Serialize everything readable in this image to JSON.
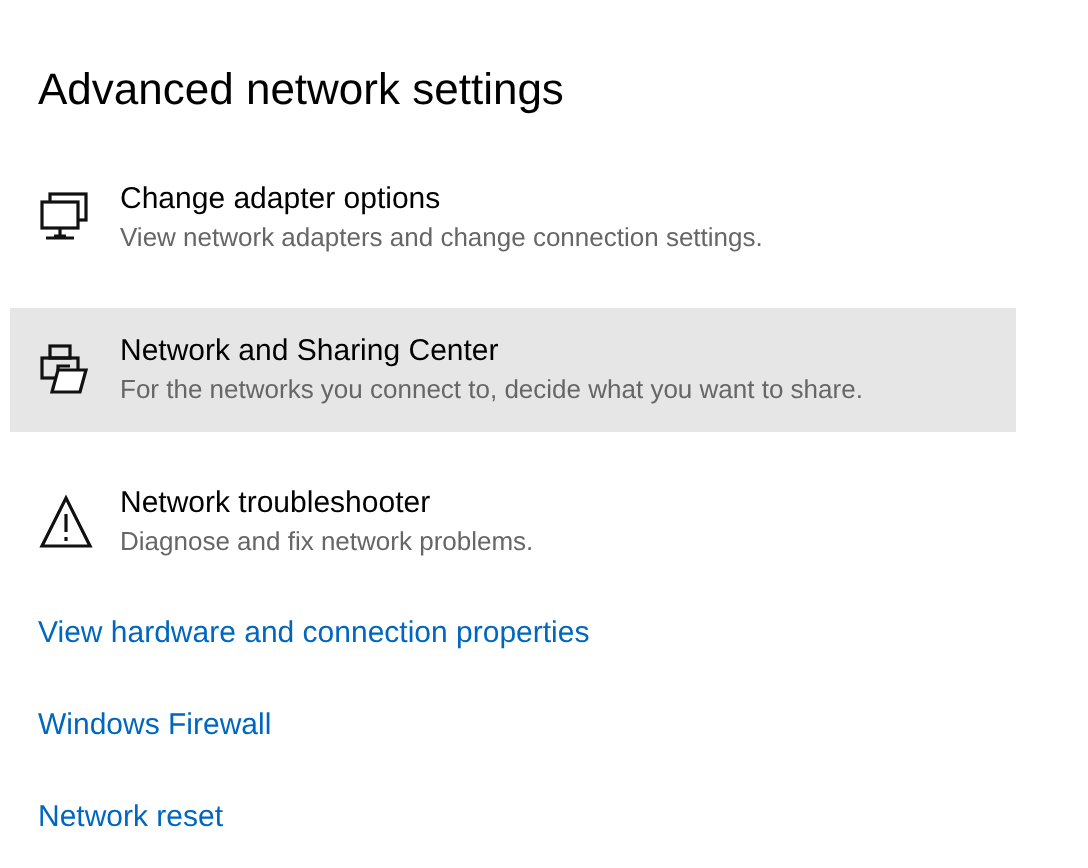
{
  "title": "Advanced network settings",
  "items": [
    {
      "kind": "adapter",
      "label": "Change adapter options",
      "description": "View network adapters and change connection settings.",
      "selected": false
    },
    {
      "kind": "sharing",
      "label": "Network and Sharing Center",
      "description": "For the networks you connect to, decide what you want to share.",
      "selected": true
    },
    {
      "kind": "troubleshooter",
      "label": "Network troubleshooter",
      "description": "Diagnose and fix network problems.",
      "selected": false
    }
  ],
  "links": [
    "View hardware and connection properties",
    "Windows Firewall",
    "Network reset"
  ]
}
